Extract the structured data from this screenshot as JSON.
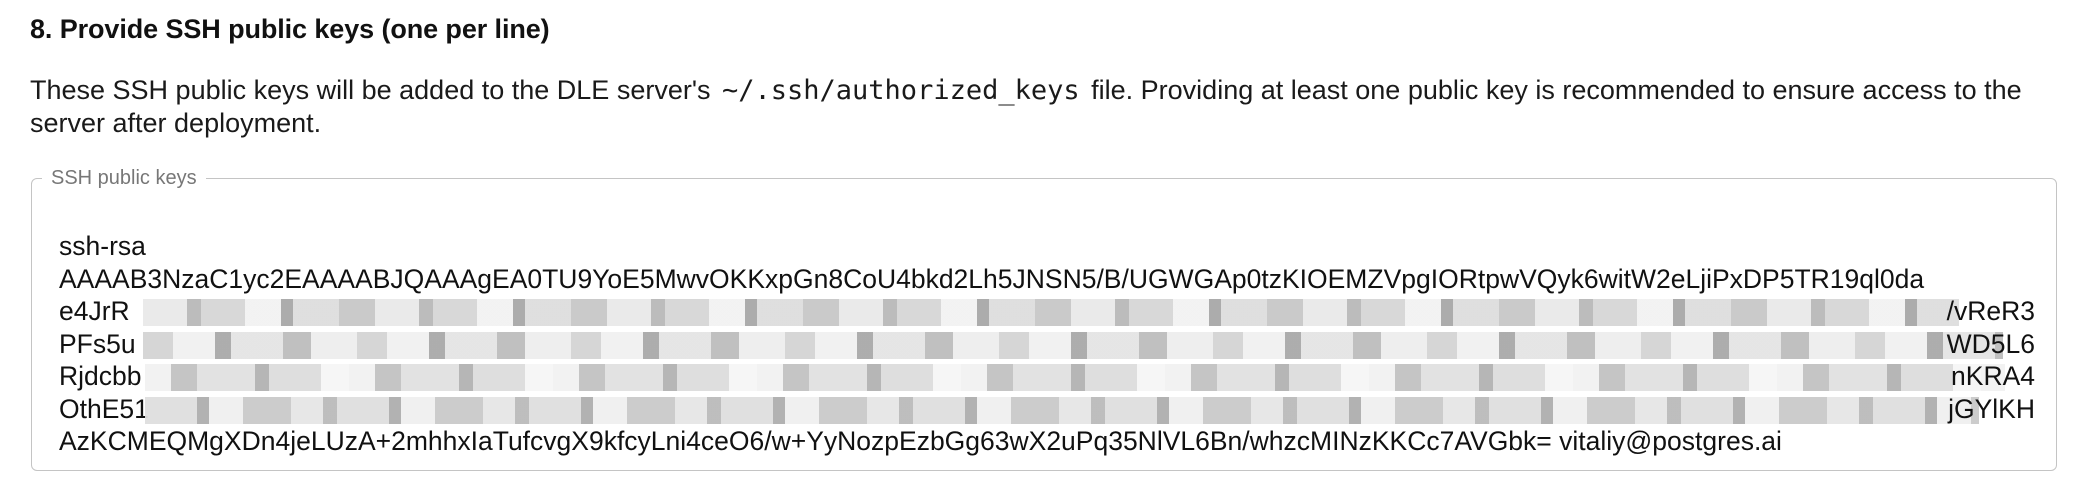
{
  "section": {
    "title": "8. Provide SSH public keys (one per line)"
  },
  "description": {
    "before": "These SSH public keys will be added to the DLE server's",
    "code": "~/.ssh/authorized_keys",
    "after": "file. Providing at least one public key is recommended to ensure access to the server after deployment."
  },
  "keys_field": {
    "label": "SSH public keys",
    "lines": {
      "l1": "ssh-rsa",
      "l2": "AAAAB3NzaC1yc2EAAAABJQAAAgEA0TU9YoE5MwvOKKxpGn8CoU4bkd2Lh5JNSN5/B/UGWGAp0tzKIOEMZVpgIORtpwVQyk6witW2eLjiPxDP5TR19ql0da",
      "l3_start": "e4JrR",
      "l3_end": "/vReR3",
      "l4_start": "PFs5u",
      "l4_end": "WD5L6",
      "l5_start": "Rjdcbb",
      "l5_end": "nKRA4",
      "l6_start": "OthE51",
      "l6_end": "jGYlKH",
      "l7": "AzKCMEQMgXDn4jeLUzA+2mhhxIaTufcvgX9kfcyLni4ceO6/w+YyNozpEzbGg63wX2uPq35NlVL6Bn/whzcMINzKKCc7AVGbk= vitaliy@postgres.ai"
    }
  }
}
